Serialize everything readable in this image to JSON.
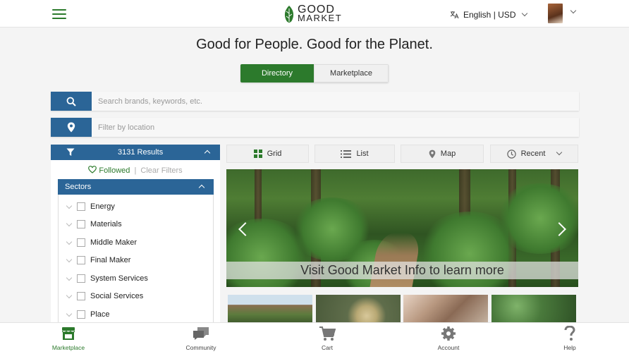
{
  "header": {
    "logo_line1": "GOOD",
    "logo_line2": "MARKET",
    "language_label": "English | USD"
  },
  "tagline": "Good for People. Good for the Planet.",
  "toggle": {
    "directory": "Directory",
    "marketplace": "Marketplace",
    "active": "Directory"
  },
  "search": {
    "placeholder": "Search brands, keywords, etc.",
    "value": ""
  },
  "location": {
    "placeholder": "Filter by location",
    "value": ""
  },
  "filters": {
    "results_label": "3131 Results",
    "followed_label": "Followed",
    "separator": "|",
    "clear_label": "Clear Filters",
    "sectors_title": "Sectors",
    "sectors": [
      {
        "label": "Energy",
        "checked": false
      },
      {
        "label": "Materials",
        "checked": false
      },
      {
        "label": "Middle Maker",
        "checked": false
      },
      {
        "label": "Final Maker",
        "checked": false
      },
      {
        "label": "System Services",
        "checked": false
      },
      {
        "label": "Social Services",
        "checked": false
      },
      {
        "label": "Place",
        "checked": false
      }
    ]
  },
  "views": {
    "grid": "Grid",
    "list": "List",
    "map": "Map",
    "sort": "Recent",
    "active": "Grid"
  },
  "hero": {
    "caption": "Visit Good Market Info to learn more"
  },
  "bottom_nav": [
    {
      "label": "Marketplace",
      "icon": "store-icon",
      "active": true
    },
    {
      "label": "Community",
      "icon": "chat-icon",
      "active": false
    },
    {
      "label": "Cart",
      "icon": "cart-icon",
      "active": false
    },
    {
      "label": "Account",
      "icon": "gear-icon",
      "active": false
    },
    {
      "label": "Help",
      "icon": "question-icon",
      "active": false
    }
  ],
  "colors": {
    "primary_green": "#2c7a2c",
    "primary_blue": "#2b6597",
    "background": "#f4f4f4"
  }
}
